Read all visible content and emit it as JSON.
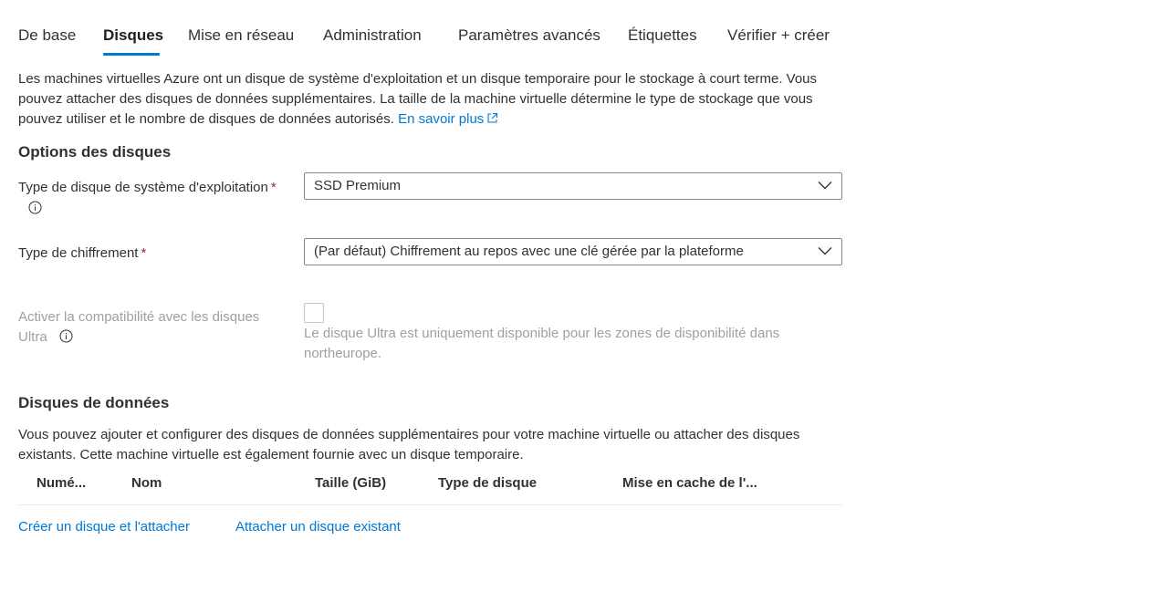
{
  "tabs": [
    {
      "label": "De base"
    },
    {
      "label": "Disques"
    },
    {
      "label": "Mise en réseau"
    },
    {
      "label": "Administration"
    },
    {
      "label": "Paramètres avancés"
    },
    {
      "label": "Étiquettes"
    },
    {
      "label": "Vérifier + créer"
    }
  ],
  "active_tab": "Disques",
  "intro": {
    "text": "Les machines virtuelles Azure ont un disque de système d'exploitation et un disque temporaire pour le stockage à court terme. Vous pouvez attacher des disques de données supplémentaires. La taille de la machine virtuelle détermine le type de stockage que vous pouvez utiliser et le nombre de disques de données autorisés.",
    "learn_more": "En savoir plus"
  },
  "disk_options": {
    "title": "Options des disques",
    "os_disk_type": {
      "label": "Type de disque de système d'exploitation",
      "required": "*",
      "value": "SSD Premium"
    },
    "encryption_type": {
      "label": "Type de chiffrement",
      "required": "*",
      "value": "(Par défaut) Chiffrement au repos avec une clé gérée par la plateforme"
    },
    "ultra": {
      "label_line1": "Activer la compatibilité avec les disques",
      "label_line2": "Ultra",
      "checked": false,
      "help": "Le disque Ultra est uniquement disponible pour les zones de disponibilité dans northeurope."
    }
  },
  "data_disks": {
    "title": "Disques de données",
    "description": "Vous pouvez ajouter et configurer des disques de données supplémentaires pour votre machine virtuelle ou attacher des disques existants. Cette machine virtuelle est également fournie avec un disque temporaire.",
    "columns": [
      "Numé...",
      "Nom",
      "Taille (GiB)",
      "Type de disque",
      "Mise en cache de l'..."
    ],
    "rows": [],
    "create_link": "Créer un disque et l'attacher",
    "attach_link": "Attacher un disque existant"
  },
  "colors": {
    "accent": "#0078d4",
    "required": "#a4262c",
    "disabled_text": "#a19f9d",
    "text": "#323130"
  },
  "icons": {
    "info": "info-icon",
    "external": "external-link-icon",
    "chevron": "chevron-down-icon"
  }
}
